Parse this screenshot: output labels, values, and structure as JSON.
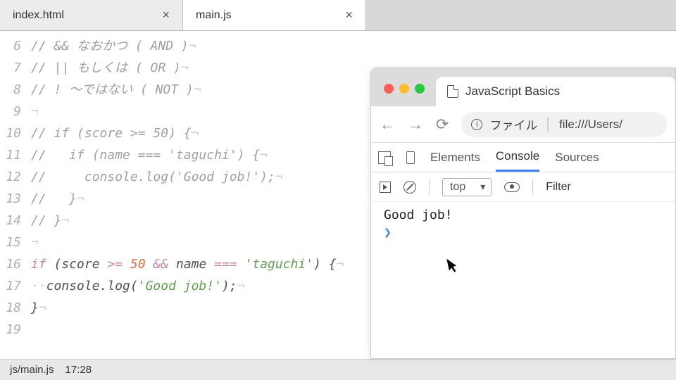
{
  "editor": {
    "tabs": [
      {
        "label": "index.html",
        "active": false
      },
      {
        "label": "main.js",
        "active": true
      }
    ],
    "lines": [
      {
        "n": 6,
        "html": "<span class='cmt'>// && なおかつ ( AND )</span><span class='nl'>¬</span>"
      },
      {
        "n": 7,
        "html": "<span class='cmt'>// || もしくは ( OR )</span><span class='nl'>¬</span>"
      },
      {
        "n": 8,
        "html": "<span class='cmt'>// ! 〜ではない ( NOT )</span><span class='nl'>¬</span>"
      },
      {
        "n": 9,
        "html": "<span class='nl'>¬</span>"
      },
      {
        "n": 10,
        "html": "<span class='cmt'>// if (score >= 50) {</span><span class='nl'>¬</span>"
      },
      {
        "n": 11,
        "html": "<span class='cmt'>//   if (name === 'taguchi') {</span><span class='nl'>¬</span>"
      },
      {
        "n": 12,
        "html": "<span class='cmt'>//     console.log('Good job!');</span><span class='nl'>¬</span>"
      },
      {
        "n": 13,
        "html": "<span class='cmt'>//   }</span><span class='nl'>¬</span>"
      },
      {
        "n": 14,
        "html": "<span class='cmt'>// }</span><span class='nl'>¬</span>"
      },
      {
        "n": 15,
        "html": "<span class='nl'>¬</span>"
      },
      {
        "n": 16,
        "html": "<span class='kw'>if</span><span class='plain'> (score </span><span class='op'>>=</span><span class='plain'> </span><span class='num'>50</span><span class='plain'> </span><span class='op'>&&</span><span class='plain'> name </span><span class='op'>===</span><span class='plain'> </span><span class='str'>'taguchi'</span><span class='plain'>) {</span><span class='nl'>¬</span>"
      },
      {
        "n": 17,
        "html": "<span class='nl'>··</span><span class='plain'>console.log(</span><span class='str'>'Good job!'</span><span class='plain'>);</span><span class='nl'>¬</span>"
      },
      {
        "n": 18,
        "html": "<span class='plain'>}</span><span class='nl'>¬</span>"
      },
      {
        "n": 19,
        "html": ""
      }
    ],
    "status": {
      "file": "js/main.js",
      "pos": "17:28"
    }
  },
  "browser": {
    "tab_title": "JavaScript Basics",
    "addr_prefix": "ファイル",
    "addr_url": "file:///Users/",
    "devtools": {
      "tabs": {
        "elements": "Elements",
        "console": "Console",
        "sources": "Sources"
      },
      "context": "top",
      "filter": "Filter"
    },
    "console_output": "Good job!",
    "prompt": "❯"
  }
}
